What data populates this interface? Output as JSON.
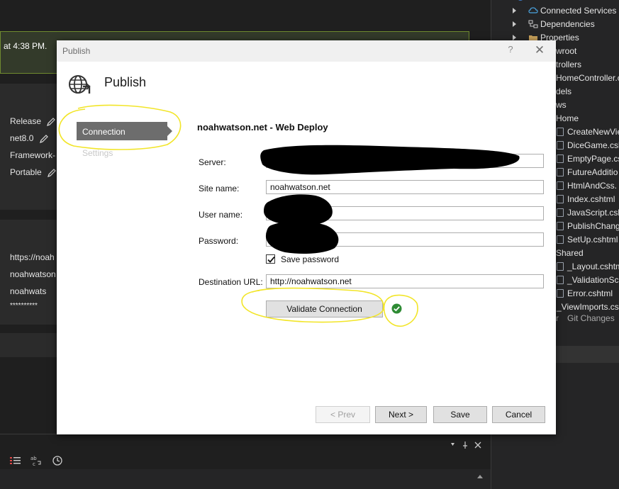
{
  "ide": {
    "notification_text": "at 4:38 PM.",
    "publish_profile": {
      "configuration": "Release",
      "framework": "net8.0",
      "deployment_mode": "Framework-",
      "target_runtime": "Portable"
    },
    "hosting": {
      "url": "https://noah",
      "site": "noahwatson",
      "user": "noahwats",
      "password": "**********"
    },
    "solution_explorer": {
      "items": [
        {
          "label": "Connected Services",
          "icon": "connected-services-icon"
        },
        {
          "label": "Dependencies",
          "icon": "dependencies-icon"
        },
        {
          "label": "Properties",
          "icon": "folder-icon"
        },
        {
          "label": "wroot"
        },
        {
          "label": "trollers"
        },
        {
          "label": "HomeController.c"
        },
        {
          "label": "dels"
        },
        {
          "label": "ws"
        },
        {
          "label": "Home"
        },
        {
          "label": "CreateNewVie"
        },
        {
          "label": "DiceGame.csh"
        },
        {
          "label": "EmptyPage.cs"
        },
        {
          "label": "FutureAdditio"
        },
        {
          "label": "HtmlAndCss."
        },
        {
          "label": "Index.cshtml"
        },
        {
          "label": "JavaScript.csh"
        },
        {
          "label": "PublishChang"
        },
        {
          "label": "SetUp.cshtml"
        },
        {
          "label": "Shared"
        },
        {
          "label": "_Layout.cshtm"
        },
        {
          "label": "_ValidationScr"
        },
        {
          "label": "Error.cshtml"
        },
        {
          "label": "_ViewImports.csh"
        }
      ],
      "tab_left": "r",
      "tab_git": "Git Changes"
    }
  },
  "dialog": {
    "title": "Publish",
    "help": "?",
    "close": "✕",
    "heading": "Publish",
    "nav": {
      "connection": "Connection",
      "settings": "Settings"
    },
    "section_title": "noahwatson.net - Web Deploy",
    "fields": {
      "server_label": "Server:",
      "server_value": "",
      "site_name_label": "Site name:",
      "site_name_value": "noahwatson.net",
      "user_name_label": "User name:",
      "user_name_value": "",
      "password_label": "Password:",
      "password_value": "",
      "save_password_label": "Save password",
      "save_password_checked": true,
      "destination_url_label": "Destination URL:",
      "destination_url_value": "http://noahwatson.net"
    },
    "validate_label": "Validate Connection",
    "validate_status": "success-check-icon",
    "buttons": {
      "prev": "< Prev",
      "next": "Next >",
      "save": "Save",
      "cancel": "Cancel"
    }
  },
  "colors": {
    "highlight": "#f2e528",
    "success": "#2e8b34",
    "nav_selected": "#6d6d6d"
  }
}
